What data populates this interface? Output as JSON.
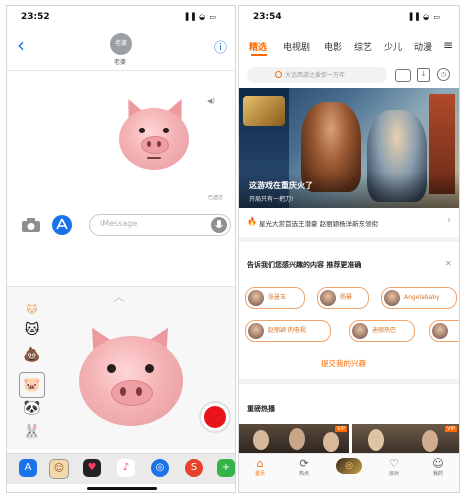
{
  "left": {
    "time": "23:52",
    "status_icons": "▐▐ ◒ ▭",
    "contact_avatar_text": "老婆",
    "contact_name": "老婆",
    "info_icon": "ⓘ",
    "back_icon": "‹",
    "sound_icon": "◀)",
    "delivered": "已送达",
    "message_placeholder": "iMessage",
    "sticker_column": [
      "猫",
      "💩",
      "🐷",
      "🐼",
      "🐰",
      "🐶"
    ],
    "dock_apps": [
      "app-store",
      "animoji",
      "heart",
      "music",
      "safari",
      "app-red",
      "app-green"
    ]
  },
  "right": {
    "time": "23:54",
    "status_icons": "▐▐ ◒ ▭",
    "tabs": [
      "精选",
      "电视剧",
      "电影",
      "综艺",
      "少儿",
      "动漫"
    ],
    "menu_icon": "≡",
    "search_placeholder": "大话西游之爱你一万年",
    "banner_caption": "这游戏在重庆火了",
    "banner_sub": "开局只有一把刀!",
    "hot_line": "星光大赏首选王潜豪 赵丽颖杨洋新东领衔",
    "interest_title": "告诉我们您感兴趣的内容 推荐更准确",
    "close_icon": "✕",
    "chips_row1": [
      "张曼玉",
      "杨幂",
      "Angelababy"
    ],
    "chips_row2": [
      "赵丽颖·的电视",
      "迪丽热巴",
      ""
    ],
    "submit": "提交我的兴趣",
    "section_title": "重磅热播",
    "vip": "VIP",
    "nav": [
      {
        "icon": "⌂",
        "label": "首页"
      },
      {
        "icon": "⟳",
        "label": "热点"
      },
      {
        "icon": "◎",
        "label": ""
      },
      {
        "icon": "♡",
        "label": "派对"
      },
      {
        "icon": "☺",
        "label": "我的"
      }
    ]
  },
  "colors": {
    "accent_orange": "#ff6a00",
    "ios_blue": "#1a73e8",
    "record_red": "#e8131b"
  }
}
